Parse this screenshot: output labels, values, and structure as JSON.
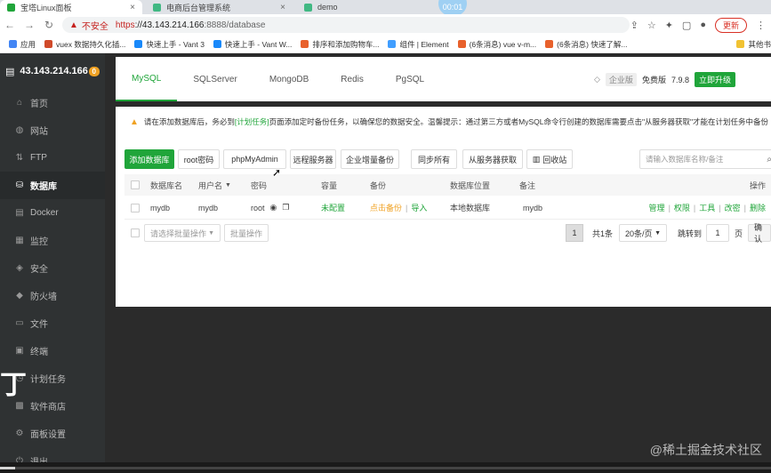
{
  "browser": {
    "tabs": [
      {
        "label": "宝塔Linux面板",
        "active": true
      },
      {
        "label": "电商后台管理系统",
        "active": false
      },
      {
        "label": "demo",
        "active": false
      }
    ],
    "timer": "00:01",
    "security_label": "不安全",
    "url_scheme": "https",
    "url_host": "://43.143.214.166",
    "url_path": ":8888/database",
    "update_label": "更新",
    "bookmarks": [
      {
        "label": "应用",
        "color": "#4285f4"
      },
      {
        "label": "vuex 数据持久化插...",
        "color": "#d04a2a"
      },
      {
        "label": "快速上手 - Vant 3",
        "color": "#1989fa"
      },
      {
        "label": "快速上手 - Vant W...",
        "color": "#1989fa"
      },
      {
        "label": "排序和添加购物车...",
        "color": "#e8612c"
      },
      {
        "label": "组件 | Element",
        "color": "#409eff"
      },
      {
        "label": "(6条消息) vue v-m...",
        "color": "#e8612c"
      },
      {
        "label": "(6条消息) 快速了解...",
        "color": "#e8612c"
      },
      {
        "label": "其他书",
        "color": "#f1c232"
      }
    ]
  },
  "sidebar": {
    "server_ip": "43.143.214.166",
    "badge": "0",
    "items": [
      {
        "label": "首页",
        "icon": "home-icon",
        "glyph": "⌂"
      },
      {
        "label": "网站",
        "icon": "globe-icon",
        "glyph": "◍"
      },
      {
        "label": "FTP",
        "icon": "ftp-icon",
        "glyph": "⇅"
      },
      {
        "label": "数据库",
        "icon": "database-icon",
        "glyph": "⛁"
      },
      {
        "label": "Docker",
        "icon": "docker-icon",
        "glyph": "▤"
      },
      {
        "label": "监控",
        "icon": "monitor-icon",
        "glyph": "▦"
      },
      {
        "label": "安全",
        "icon": "shield-icon",
        "glyph": "◈"
      },
      {
        "label": "防火墙",
        "icon": "firewall-icon",
        "glyph": "◆"
      },
      {
        "label": "文件",
        "icon": "folder-icon",
        "glyph": "▭"
      },
      {
        "label": "终端",
        "icon": "terminal-icon",
        "glyph": "▣"
      },
      {
        "label": "计划任务",
        "icon": "clock-icon",
        "glyph": "◷"
      },
      {
        "label": "软件商店",
        "icon": "store-icon",
        "glyph": "▩"
      },
      {
        "label": "面板设置",
        "icon": "settings-icon",
        "glyph": "⚙"
      },
      {
        "label": "退出",
        "icon": "logout-icon",
        "glyph": "⏻"
      }
    ],
    "active_index": 3
  },
  "db_tabs": [
    "MySQL",
    "SQLServer",
    "MongoDB",
    "Redis",
    "PgSQL"
  ],
  "edition": {
    "label": "企业版",
    "free": "免费版",
    "version": "7.9.8",
    "upgrade": "立即升级"
  },
  "notice": {
    "pre": "请在添加数据库后，务必到",
    "link": "[计划任务]",
    "post": "页面添加定时备份任务，以确保您的数据安全。温馨提示：通过第三方或者MySQL命令行创建的数据库需要点击\"从服务器获取\"才能在计划任务中备份"
  },
  "toolbar": {
    "add_db": "添加数据库",
    "root_pwd": "root密码",
    "phpmyadmin": "phpMyAdmin",
    "remote": "远程服务器",
    "incr_backup": "企业增量备份",
    "sync_all": "同步所有",
    "fetch": "从服务器获取",
    "recycle": "回收站",
    "search_placeholder": "请输入数据库名称/备注"
  },
  "table": {
    "headers": [
      "数据库名",
      "用户名",
      "密码",
      "容量",
      "备份",
      "数据库位置",
      "备注",
      "操作"
    ],
    "rows": [
      {
        "name": "mydb",
        "user": "mydb",
        "password": "root",
        "capacity": "未配置",
        "backup_click": "点击备份",
        "backup_import": "导入",
        "location": "本地数据库",
        "remark": "mydb",
        "actions": [
          "管理",
          "权限",
          "工具",
          "改密",
          "删除"
        ]
      }
    ]
  },
  "footer": {
    "batch_placeholder": "请选择批量操作",
    "batch_btn": "批量操作",
    "current_page": "1",
    "total": "共1条",
    "per_page": "20条/页",
    "jump_label": "跳转到",
    "jump_value": "1",
    "page_unit": "页",
    "confirm": "确认"
  },
  "overlay": {
    "big_char": "丁",
    "watermark": "@稀土掘金技术社区",
    "video_progress": 0.02
  }
}
